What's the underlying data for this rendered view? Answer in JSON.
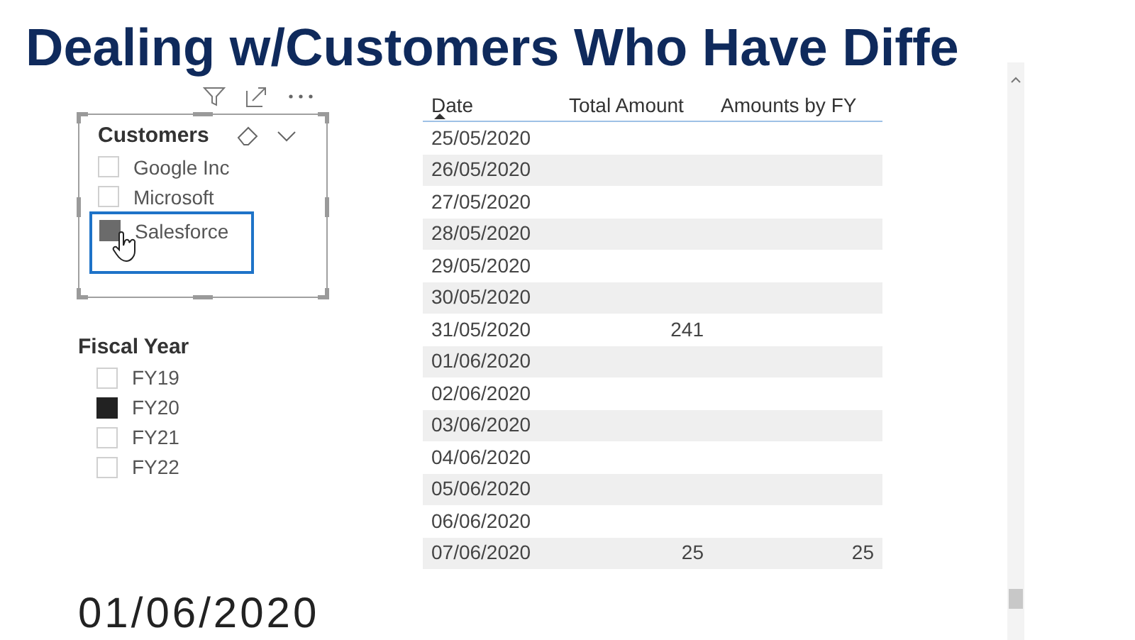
{
  "title": "Dealing w/Customers Who Have Diffe",
  "customers_slicer": {
    "title": "Customers",
    "items": [
      {
        "label": "Google Inc",
        "checked": false,
        "highlighted": false
      },
      {
        "label": "Microsoft",
        "checked": false,
        "highlighted": false
      },
      {
        "label": "Salesforce",
        "checked": true,
        "highlighted": true
      }
    ]
  },
  "fiscal_year_slicer": {
    "title": "Fiscal Year",
    "items": [
      {
        "label": "FY19",
        "checked": false
      },
      {
        "label": "FY20",
        "checked": true
      },
      {
        "label": "FY21",
        "checked": false
      },
      {
        "label": "FY22",
        "checked": false
      }
    ]
  },
  "card_value": "01/06/2020",
  "table": {
    "columns": [
      "Date",
      "Total Amount",
      "Amounts by FY"
    ],
    "rows": [
      [
        "25/05/2020",
        "",
        ""
      ],
      [
        "26/05/2020",
        "",
        ""
      ],
      [
        "27/05/2020",
        "",
        ""
      ],
      [
        "28/05/2020",
        "",
        ""
      ],
      [
        "29/05/2020",
        "",
        ""
      ],
      [
        "30/05/2020",
        "",
        ""
      ],
      [
        "31/05/2020",
        "241",
        ""
      ],
      [
        "01/06/2020",
        "",
        ""
      ],
      [
        "02/06/2020",
        "",
        ""
      ],
      [
        "03/06/2020",
        "",
        ""
      ],
      [
        "04/06/2020",
        "",
        ""
      ],
      [
        "05/06/2020",
        "",
        ""
      ],
      [
        "06/06/2020",
        "",
        ""
      ],
      [
        "07/06/2020",
        "25",
        "25"
      ]
    ]
  }
}
